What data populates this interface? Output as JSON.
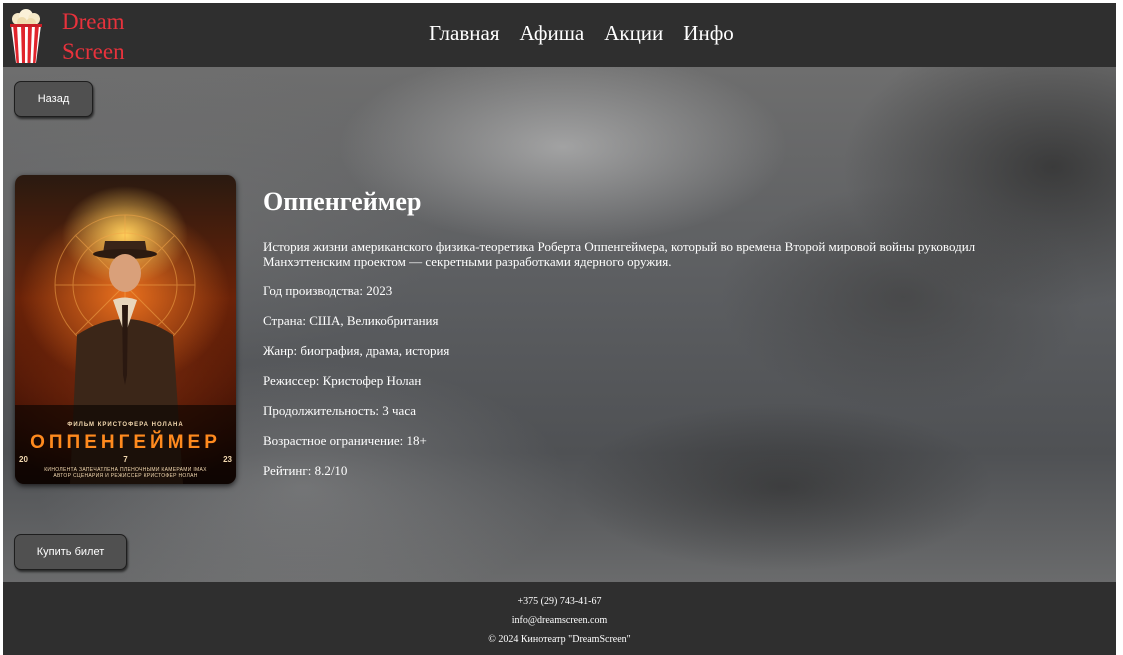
{
  "brand": {
    "line1": "Dream",
    "line2": "Screen",
    "accent": "#e8323c"
  },
  "nav": [
    "Главная",
    "Афиша",
    "Акции",
    "Инфо"
  ],
  "buttons": {
    "back": "Назад",
    "buy": "Купить билет"
  },
  "poster": {
    "director_line": "ФИЛЬМ КРИСТОФЕРА НОЛАНА",
    "title": "ОППЕНГЕЙМЕР",
    "date_parts": [
      "20",
      "7",
      "23"
    ],
    "tagline": "КИНОЛЕНТА ЗАПЕЧАТЛЕНА ПЛЕНОЧНЫМИ КАМЕРАМИ IMAX",
    "tagline2": "АВТОР СЦЕНАРИЯ И РЕЖИССЕР КРИСТОФЕР НОЛАН"
  },
  "movie": {
    "title": "Оппенгеймер",
    "description": "История жизни американского физика-теоретика Роберта Оппенгеймера, который во времена Второй мировой войны руководил Манхэттенским проектом — секретными разработками ядерного оружия.",
    "year": "Год производства: 2023",
    "country": "Страна: США, Великобритания",
    "genre": "Жанр: биография, драма, история",
    "director": "Режиссер: Кристофер Нолан",
    "duration": "Продолжительность: 3 часа",
    "age": "Возрастное ограничение: 18+",
    "rating": "Рейтинг: 8.2/10"
  },
  "footer": {
    "phone": "+375 (29) 743-41-67",
    "email": "info@dreamscreen.com",
    "copyright": "© 2024 Кинотеатр \"DreamScreen\""
  }
}
